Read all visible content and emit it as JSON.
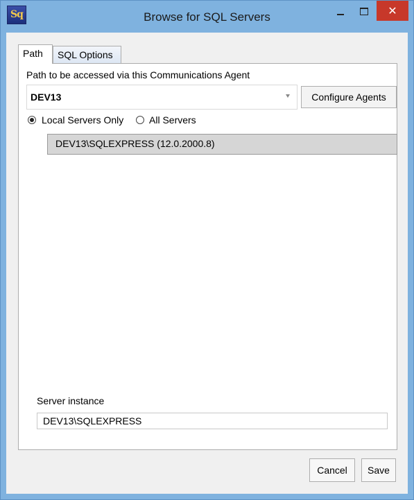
{
  "window": {
    "title": "Browse for SQL Servers",
    "icon_text": "Sq",
    "close_glyph": "✕"
  },
  "tabs": [
    {
      "label": "Path",
      "active": true
    },
    {
      "label": "SQL Options",
      "active": false
    }
  ],
  "path": {
    "label": "Path to be accessed via this Communications Agent",
    "agent_selected": "DEV13",
    "configure_button": "Configure Agents"
  },
  "scope": {
    "local_label": "Local Servers Only",
    "all_label": "All Servers",
    "selected": "local"
  },
  "servers": [
    "DEV13\\SQLEXPRESS (12.0.2000.8)"
  ],
  "instance": {
    "label": "Server instance",
    "value": "DEV13\\SQLEXPRESS"
  },
  "buttons": {
    "cancel": "Cancel",
    "save": "Save"
  },
  "colors": {
    "frame": "#7fb2df",
    "close": "#c7382a"
  }
}
